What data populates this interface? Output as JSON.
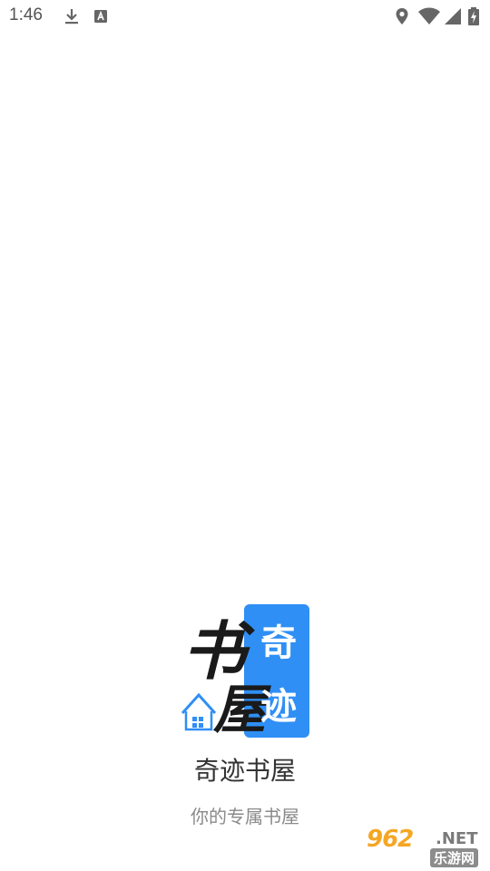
{
  "status_bar": {
    "time": "1:46",
    "icons": [
      "download-icon",
      "text-notification-icon",
      "location-icon",
      "wifi-icon",
      "cell-signal-icon",
      "battery-charging-icon"
    ]
  },
  "splash": {
    "logo": {
      "calligraphy_text": "书屋",
      "panel_text": "奇迹",
      "panel_color": "#2f8ff5"
    },
    "app_name": "奇迹书屋",
    "slogan": "你的专属书屋"
  },
  "watermark": {
    "number": "962",
    "domain": ".NET",
    "site_name": "乐游网"
  },
  "colors": {
    "background": "#ffffff",
    "accent_blue": "#2f8ff5",
    "watermark_orange": "#f5a623"
  }
}
